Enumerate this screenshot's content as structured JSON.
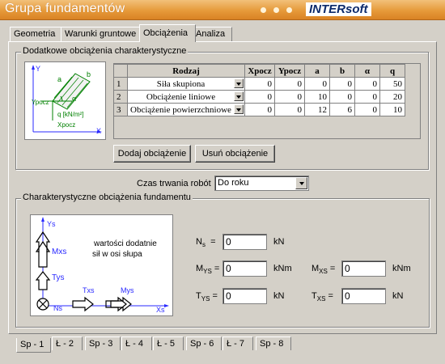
{
  "window": {
    "title": "Grupa fundamentów",
    "brand": "INTERsoft"
  },
  "tabs_top": [
    "Geometria",
    "Warunki gruntowe",
    "Obciążenia",
    "Analiza"
  ],
  "active_tab": "Obciążenia",
  "additional_loads": {
    "legend": "Dodatkowe obciążenia charakterystyczne",
    "diagram_labels": {
      "y": "Y",
      "x": "X",
      "a": "a",
      "b": "b",
      "alpha": "α",
      "ypocz": "Ypocz",
      "xpocz": "Xpocz",
      "q": "q [kN/m²]"
    },
    "table": {
      "headers": [
        "Rodzaj",
        "Xpocz",
        "Ypocz",
        "a",
        "b",
        "α",
        "q"
      ],
      "rows": [
        {
          "idx": "1",
          "rodzaj": "Siła skupiona",
          "xpocz": "0",
          "ypocz": "0",
          "a": "0",
          "b": "0",
          "alpha": "0",
          "q": "50"
        },
        {
          "idx": "2",
          "rodzaj": "Obciążenie liniowe",
          "xpocz": "0",
          "ypocz": "0",
          "a": "10",
          "b": "0",
          "alpha": "0",
          "q": "20"
        },
        {
          "idx": "3",
          "rodzaj": "Obciążenie powierzchniowe",
          "xpocz": "0",
          "ypocz": "0",
          "a": "12",
          "b": "6",
          "alpha": "0",
          "q": "10"
        }
      ]
    },
    "add_button": "Dodaj obciążenie",
    "remove_button": "Usuń obciążenie"
  },
  "duration": {
    "label": "Czas trwania robót",
    "value": "Do roku"
  },
  "foundation_loads": {
    "legend": "Charakterystyczne obciążenia fundamentu",
    "note_line1": "wartości dodatnie",
    "note_line2": "sił w osi słupa",
    "diagram": {
      "ys": "Ys",
      "mxs": "Mxs",
      "tys": "Tys",
      "ns": "Ns",
      "txs": "Txs",
      "mys": "Mys",
      "xs": "Xs"
    },
    "fields": {
      "ns": {
        "label_main": "N",
        "label_sub": "s",
        "value": "0",
        "unit": "kN"
      },
      "mys": {
        "label_main": "M",
        "label_sub": "YS",
        "value": "0",
        "unit": "kNm"
      },
      "mxs": {
        "label_main": "M",
        "label_sub": "XS",
        "value": "0",
        "unit": "kNm"
      },
      "tys": {
        "label_main": "T",
        "label_sub": "YS",
        "value": "0",
        "unit": "kN"
      },
      "txs": {
        "label_main": "T",
        "label_sub": "XS",
        "value": "0",
        "unit": "kN"
      }
    }
  },
  "tabs_bottom": [
    "Sp - 1",
    "Ł - 2",
    "Sp - 3",
    "Ł - 4",
    "Ł - 5",
    "Sp - 6",
    "Ł - 7",
    "Sp - 8"
  ],
  "active_bottom_tab": "Sp - 1",
  "colors": {
    "titlebar": "#e69a3a",
    "brand_text": "#0c2a6b",
    "window_bg": "#d4d0c8",
    "diagram_blue": "#2a2aff",
    "diagram_green": "#008000"
  }
}
